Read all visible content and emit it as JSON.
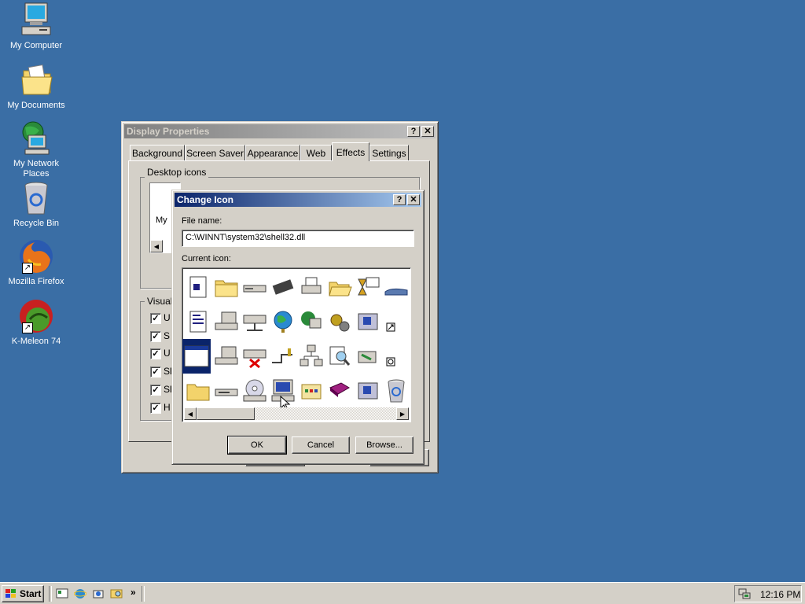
{
  "desktop": {
    "icons": [
      {
        "label": "My Computer",
        "icon": "my-computer-icon"
      },
      {
        "label": "My Documents",
        "icon": "my-documents-icon"
      },
      {
        "label": "My Network Places",
        "icon": "network-places-icon"
      },
      {
        "label": "Recycle Bin",
        "icon": "recycle-bin-icon"
      },
      {
        "label": "Mozilla Firefox",
        "icon": "firefox-icon"
      },
      {
        "label": "K-Meleon 74",
        "icon": "k-meleon-icon"
      }
    ]
  },
  "display_properties": {
    "title": "Display Properties",
    "tabs": [
      "Background",
      "Screen Saver",
      "Appearance",
      "Web",
      "Effects",
      "Settings"
    ],
    "selected_tab": "Effects",
    "desktop_icons_group": "Desktop icons",
    "desktop_icons_partial": "My",
    "visual_group": "Visual",
    "visual_items": [
      "U",
      "S",
      "U",
      "Sl",
      "Sl",
      "H"
    ]
  },
  "change_icon": {
    "title": "Change Icon",
    "file_name_label": "File name:",
    "file_name_value": "C:\\WINNT\\system32\\shell32.dll",
    "current_icon_label": "Current icon:",
    "ok_label": "OK",
    "cancel_label": "Cancel",
    "browse_label": "Browse..."
  },
  "taskbar": {
    "start_label": "Start",
    "chevron": "»",
    "clock": "12:16 PM"
  },
  "colors": {
    "desktop": "#3a6ea5",
    "face": "#d4d0c8",
    "title_active": "#0a246a"
  }
}
